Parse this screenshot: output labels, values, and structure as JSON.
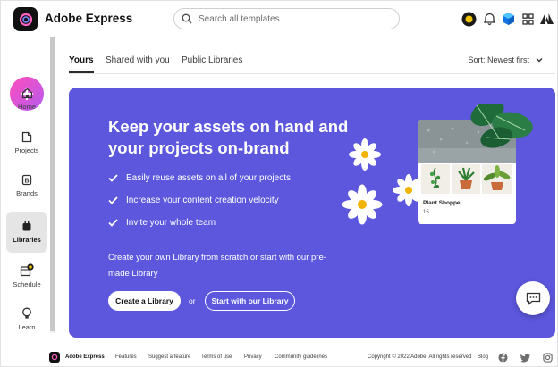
{
  "app": {
    "title": "Adobe Express"
  },
  "search": {
    "placeholder": "Search all templates"
  },
  "rail": {
    "items": [
      {
        "label": "Home",
        "icon": "home-icon"
      },
      {
        "label": "Projects",
        "icon": "projects-icon"
      },
      {
        "label": "Brands",
        "icon": "brands-icon"
      },
      {
        "label": "Libraries",
        "icon": "libraries-icon",
        "active": true
      },
      {
        "label": "Schedule",
        "icon": "schedule-icon"
      },
      {
        "label": "Learn",
        "icon": "learn-icon"
      }
    ]
  },
  "tabs": {
    "items": [
      {
        "label": "Yours",
        "active": true
      },
      {
        "label": "Shared with you"
      },
      {
        "label": "Public Libraries"
      }
    ],
    "sort_label": "Sort: Newest first"
  },
  "banner": {
    "heading": "Keep your assets on hand and your projects on-brand",
    "features": [
      "Easily reuse assets on all of your projects",
      "Increase your content creation velocity",
      "Invite your whole team"
    ],
    "cta_text": "Create your own Library from scratch or start with our pre-made Library",
    "create_button": "Create a Library",
    "or": "or",
    "start_button": "Start with our Library",
    "card_title": "Plant Shoppe",
    "card_count": "15",
    "color": "#5c57dc"
  },
  "footer": {
    "app_title": "Adobe Express",
    "links": [
      "Features",
      "Suggest a feature",
      "Terms of use",
      "Privacy",
      "Community guidelines"
    ],
    "copyright": "Copyright © 2022 Adobe. All rights reserved",
    "blog": "Blog"
  }
}
